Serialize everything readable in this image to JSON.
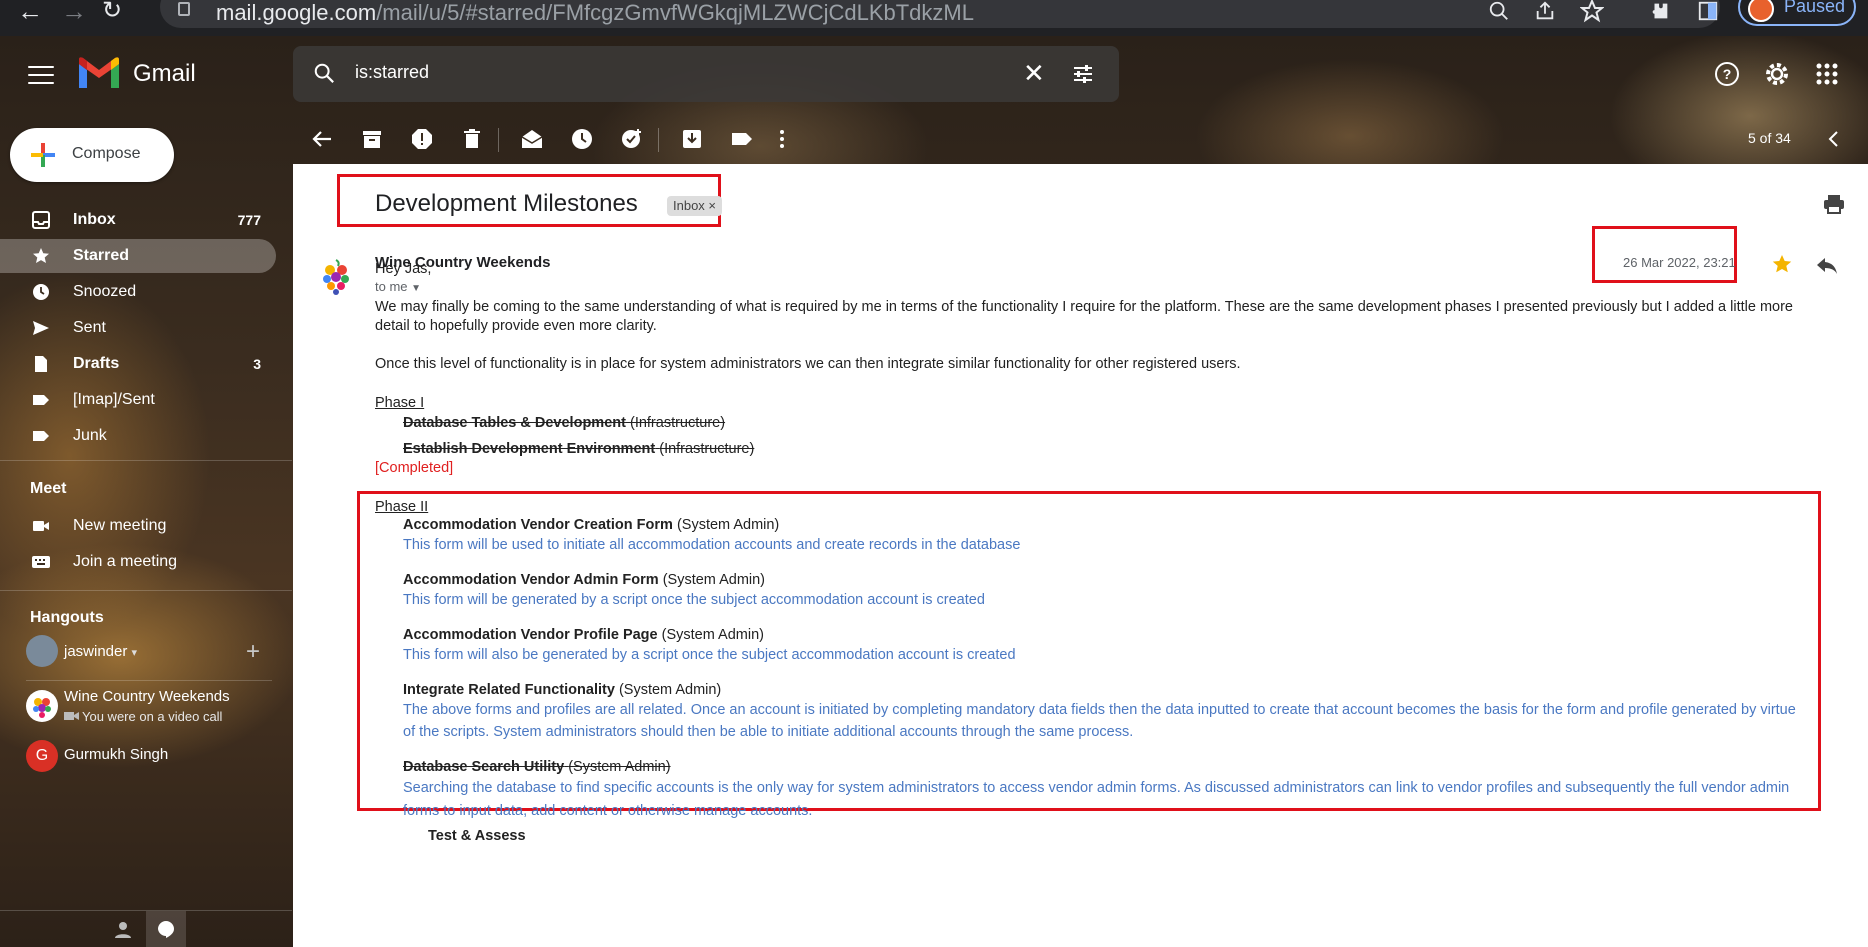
{
  "browser": {
    "url_host": "mail.google.com",
    "url_path": "/mail/u/5/#starred/FMfcgzGmvfWGkqjMLZWCjCdLKbTdkzML",
    "profile_status": "Paused"
  },
  "header": {
    "app_name": "Gmail",
    "search_value": "is:starred"
  },
  "sidebar": {
    "compose_label": "Compose",
    "items": [
      {
        "label": "Inbox",
        "count": "777",
        "icon": "inbox-icon"
      },
      {
        "label": "Starred",
        "count": "",
        "icon": "star-icon"
      },
      {
        "label": "Snoozed",
        "count": "",
        "icon": "clock-icon"
      },
      {
        "label": "Sent",
        "count": "",
        "icon": "send-icon"
      },
      {
        "label": "Drafts",
        "count": "3",
        "icon": "draft-icon"
      },
      {
        "label": "[Imap]/Sent",
        "count": "",
        "icon": "label-icon"
      },
      {
        "label": "Junk",
        "count": "",
        "icon": "label-icon"
      }
    ],
    "meet": {
      "title": "Meet",
      "new_meeting": "New meeting",
      "join_meeting": "Join a meeting"
    },
    "hangouts": {
      "title": "Hangouts",
      "user": "jaswinder",
      "contacts": [
        {
          "name": "Wine Country Weekends",
          "status": "You were on a video call"
        },
        {
          "name": "Gurmukh Singh",
          "initial": "G"
        }
      ]
    }
  },
  "toolbar": {
    "page_count": "5 of 34"
  },
  "message": {
    "subject": "Development Milestones",
    "label_chip": "Inbox ×",
    "sender": "Wine Country Weekends",
    "to": "to me",
    "date": "26 Mar 2022, 23:21",
    "greeting": "Hey Jas,",
    "para1_line1": "We may finally be coming to the same understanding of what is required by me in terms of the functionality I require for the platform.  These are the same development phases I presented previously but I added a little more",
    "para1_line2": "detail to hopefully provide even more clarity.",
    "para2": "Once this level of functionality is in place for system administrators we can then integrate similar functionality for other registered users.",
    "phase1": {
      "title": "Phase I",
      "items": [
        {
          "name": "Database Tables & Development",
          "role": "(Infrastructure)"
        },
        {
          "name": "Establish Development Environment",
          "role": "(Infrastructure)"
        }
      ],
      "status": "[Completed]"
    },
    "phase2": {
      "title": "Phase II",
      "items": [
        {
          "name": "Accommodation Vendor Creation Form",
          "role": "(System Admin)",
          "desc1": "This form will be used to initiate all accommodation accounts and create records in the database",
          "desc2": ""
        },
        {
          "name": "Accommodation Vendor Admin Form",
          "role": "(System Admin)",
          "desc1": "This form will be generated by a script once the subject accommodation account is created",
          "desc2": ""
        },
        {
          "name": "Accommodation Vendor Profile Page",
          "role": "(System Admin)",
          "desc1": "This form will also be generated by a script once the subject accommodation account is created",
          "desc2": ""
        },
        {
          "name": "Integrate Related Functionality",
          "role": "(System Admin)",
          "desc1": "The above forms and profiles are all related.  Once an account is initiated by completing mandatory data fields then the data inputted to create that account becomes the basis for the form and profile generated by virtue",
          "desc2": "of the scripts.  System administrators should then be able to initiate additional accounts through the same process."
        },
        {
          "name": "Database Search Utility",
          "role": "(System Admin)",
          "desc1": "Searching the database to find specific accounts is the only way for system administrators to access vendor admin forms.  As discussed administrators can link to vendor profiles and subsequently the full vendor admin",
          "desc2": "forms to input data, add content or otherwise manage accounts."
        }
      ],
      "next_item": "Test & Assess"
    }
  },
  "colors": {
    "accent_red": "#e0101a",
    "link_blue": "#4a78c2",
    "star_yellow": "#f4b400"
  }
}
